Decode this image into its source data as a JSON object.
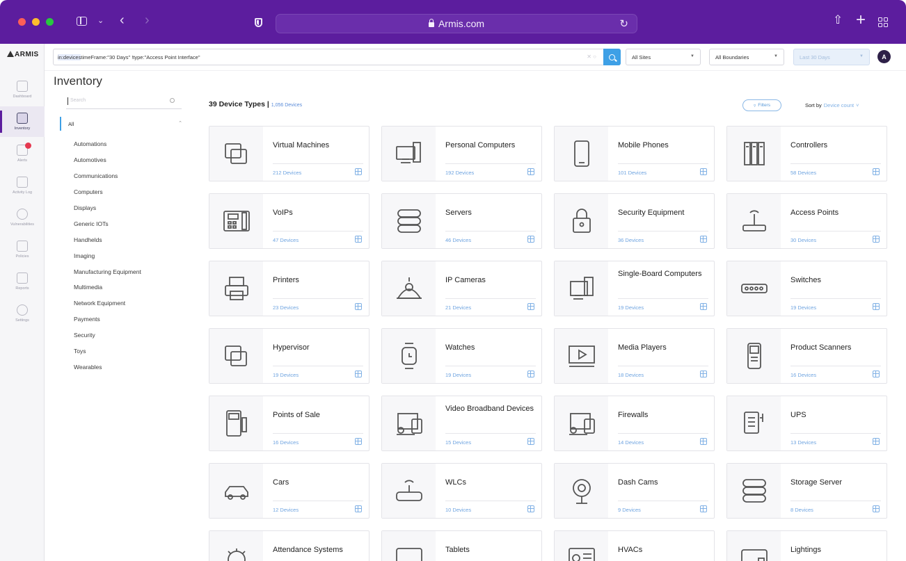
{
  "browser": {
    "url": "Armis.com"
  },
  "app": {
    "logo": "ARMIS",
    "nav": [
      {
        "label": "Dashboard",
        "icon": "dashboard-icon"
      },
      {
        "label": "Inventory",
        "icon": "inventory-icon",
        "active": true
      },
      {
        "label": "Alerts",
        "icon": "alerts-icon"
      },
      {
        "label": "Activity Log",
        "icon": "activity-log-icon"
      },
      {
        "label": "Vulnerabilities",
        "icon": "vulnerabilities-icon"
      },
      {
        "label": "Policies",
        "icon": "policies-icon"
      },
      {
        "label": "Reports",
        "icon": "reports-icon"
      },
      {
        "label": "Settings",
        "icon": "settings-icon"
      }
    ]
  },
  "query": {
    "highlight": "in:devices",
    "rest": " timeFrame:\"30 Days\" !type:\"Access Point Interface\""
  },
  "filters_bar": {
    "sites": "All Sites",
    "boundaries": "All Boundaries",
    "time": "Last 30 Days",
    "avatar": "A"
  },
  "page": {
    "title": "Inventory"
  },
  "categories": {
    "search_placeholder": "Search",
    "all": "All",
    "items": [
      "Automations",
      "Automotives",
      "Communications",
      "Computers",
      "Displays",
      "Generic IOTs",
      "Handhelds",
      "Imaging",
      "Manufacturing Equipment",
      "Multimedia",
      "Network Equipment",
      "Payments",
      "Security",
      "Toys",
      "Wearables"
    ]
  },
  "summary": {
    "types": "39 Device Types",
    "sep": " | ",
    "devices": "1,056 Devices",
    "filters": "Filters",
    "sort_label": "Sort by",
    "sort_value": "Device count"
  },
  "cards": [
    {
      "name": "Virtual Machines",
      "count": "212 Devices",
      "icon": "virtual-machines-icon"
    },
    {
      "name": "Personal Computers",
      "count": "192 Devices",
      "icon": "personal-computer-icon"
    },
    {
      "name": "Mobile Phones",
      "count": "101 Devices",
      "icon": "mobile-phone-icon"
    },
    {
      "name": "Controllers",
      "count": "58 Devices",
      "icon": "controller-icon"
    },
    {
      "name": "VoIPs",
      "count": "47 Devices",
      "icon": "voip-phone-icon"
    },
    {
      "name": "Servers",
      "count": "46 Devices",
      "icon": "server-icon"
    },
    {
      "name": "Security Equipment",
      "count": "36 Devices",
      "icon": "padlock-icon"
    },
    {
      "name": "Access Points",
      "count": "30 Devices",
      "icon": "access-point-icon"
    },
    {
      "name": "Printers",
      "count": "23 Devices",
      "icon": "printer-icon"
    },
    {
      "name": "IP Cameras",
      "count": "21 Devices",
      "icon": "ip-camera-icon"
    },
    {
      "name": "Single-Board Computers",
      "count": "19 Devices",
      "icon": "single-board-computer-icon"
    },
    {
      "name": "Switches",
      "count": "19 Devices",
      "icon": "switch-icon"
    },
    {
      "name": "Hypervisor",
      "count": "19 Devices",
      "icon": "hypervisor-icon"
    },
    {
      "name": "Watches",
      "count": "19 Devices",
      "icon": "watch-icon"
    },
    {
      "name": "Media Players",
      "count": "18 Devices",
      "icon": "media-player-icon"
    },
    {
      "name": "Product Scanners",
      "count": "16 Devices",
      "icon": "scanner-icon"
    },
    {
      "name": "Points of Sale",
      "count": "16 Devices",
      "icon": "point-of-sale-icon"
    },
    {
      "name": "Video Broadband Devices",
      "count": "15 Devices",
      "icon": "video-broadband-icon"
    },
    {
      "name": "Firewalls",
      "count": "14 Devices",
      "icon": "firewall-icon"
    },
    {
      "name": "UPS",
      "count": "13 Devices",
      "icon": "ups-icon"
    },
    {
      "name": "Cars",
      "count": "12 Devices",
      "icon": "car-icon"
    },
    {
      "name": "WLCs",
      "count": "10 Devices",
      "icon": "wlc-icon"
    },
    {
      "name": "Dash Cams",
      "count": "9 Devices",
      "icon": "dash-cam-icon"
    },
    {
      "name": "Storage Server",
      "count": "8 Devices",
      "icon": "storage-server-icon"
    },
    {
      "name": "Attendance Systems",
      "count": "",
      "icon": "attendance-system-icon"
    },
    {
      "name": "Tablets",
      "count": "",
      "icon": "tablet-icon"
    },
    {
      "name": "HVACs",
      "count": "",
      "icon": "hvac-icon"
    },
    {
      "name": "Lightings",
      "count": "",
      "icon": "lighting-icon"
    }
  ],
  "colors": {
    "chrome": "#5c1d9e",
    "accent": "#3ea0e6",
    "link": "#6fa4e0"
  }
}
